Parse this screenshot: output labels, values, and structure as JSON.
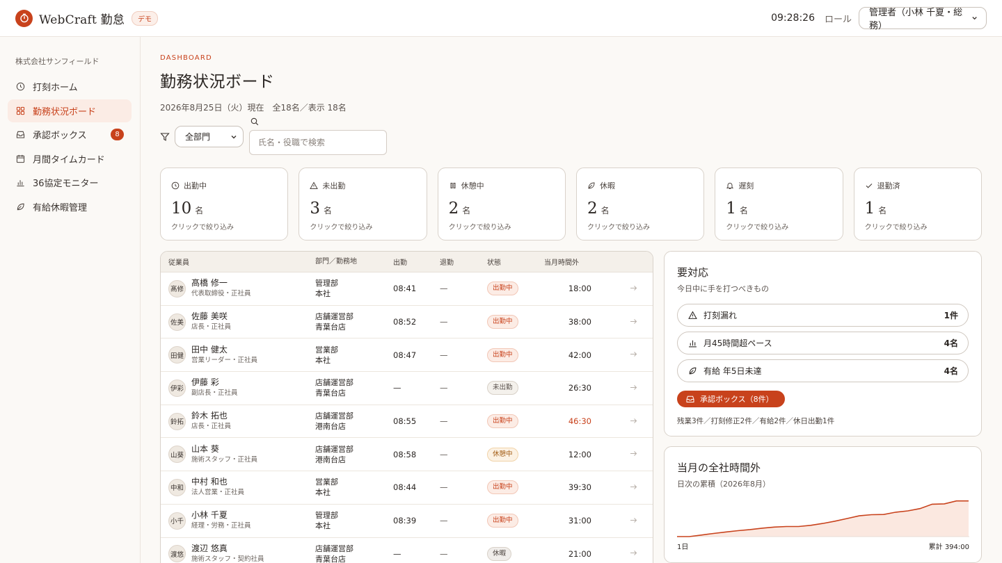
{
  "app": {
    "title": "WebCraft 勤怠",
    "demo_badge": "デモ"
  },
  "header": {
    "clock": "09:28:26",
    "role_label": "ロール",
    "role_value": "管理者（小林 千夏・総務）"
  },
  "sidebar": {
    "company": "株式会社サンフィールド",
    "items": [
      {
        "label": "打刻ホーム",
        "icon": "clock-icon"
      },
      {
        "label": "勤務状況ボード",
        "icon": "grid-icon",
        "active": true
      },
      {
        "label": "承認ボックス",
        "icon": "inbox-icon",
        "badge": "8"
      },
      {
        "label": "月間タイムカード",
        "icon": "calendar-icon"
      },
      {
        "label": "36協定モニター",
        "icon": "bar-chart-icon"
      },
      {
        "label": "有給休暇管理",
        "icon": "leaf-icon"
      }
    ]
  },
  "page": {
    "eyebrow": "DASHBOARD",
    "title": "勤務状況ボード",
    "subline": "2026年8月25日（火）現在　全18名／表示 18名"
  },
  "filters": {
    "department_value": "全部門",
    "search_placeholder": "氏名・役職で検索"
  },
  "stats": [
    {
      "label": "出勤中",
      "value": "10",
      "unit": "名",
      "hint": "クリックで絞り込み",
      "icon": "clock-icon"
    },
    {
      "label": "未出勤",
      "value": "3",
      "unit": "名",
      "hint": "クリックで絞り込み",
      "icon": "warning-icon"
    },
    {
      "label": "休憩中",
      "value": "2",
      "unit": "名",
      "hint": "クリックで絞り込み",
      "icon": "pause-icon"
    },
    {
      "label": "休暇",
      "value": "2",
      "unit": "名",
      "hint": "クリックで絞り込み",
      "icon": "leaf-icon"
    },
    {
      "label": "遅刻",
      "value": "1",
      "unit": "名",
      "hint": "クリックで絞り込み",
      "icon": "bell-icon"
    },
    {
      "label": "退勤済",
      "value": "1",
      "unit": "名",
      "hint": "クリックで絞り込み",
      "icon": "check-icon"
    }
  ],
  "table": {
    "headers": {
      "employee": "従業員",
      "dept": "部門／勤務地",
      "in": "出勤",
      "out": "退勤",
      "status": "状態",
      "overtime": "当月時間外"
    },
    "rows": [
      {
        "avatar": "髙修",
        "name": "髙橋 修一",
        "role": "代表取締役・正社員",
        "dept": "管理部",
        "site": "本社",
        "in": "08:41",
        "out": "—",
        "status": "出勤中",
        "status_type": "work",
        "overtime": "18:00",
        "warn": false
      },
      {
        "avatar": "佐美",
        "name": "佐藤 美咲",
        "role": "店長・正社員",
        "dept": "店舗運営部",
        "site": "青葉台店",
        "in": "08:52",
        "out": "—",
        "status": "出勤中",
        "status_type": "work",
        "overtime": "38:00",
        "warn": false
      },
      {
        "avatar": "田健",
        "name": "田中 健太",
        "role": "営業リーダー・正社員",
        "dept": "営業部",
        "site": "本社",
        "in": "08:47",
        "out": "—",
        "status": "出勤中",
        "status_type": "work",
        "overtime": "42:00",
        "warn": false
      },
      {
        "avatar": "伊彩",
        "name": "伊藤 彩",
        "role": "副店長・正社員",
        "dept": "店舗運営部",
        "site": "青葉台店",
        "in": "—",
        "out": "—",
        "status": "未出勤",
        "status_type": "absent",
        "overtime": "26:30",
        "warn": false
      },
      {
        "avatar": "鈴拓",
        "name": "鈴木 拓也",
        "role": "店長・正社員",
        "dept": "店舗運営部",
        "site": "港南台店",
        "in": "08:55",
        "out": "—",
        "status": "出勤中",
        "status_type": "work",
        "overtime": "46:30",
        "warn": true
      },
      {
        "avatar": "山葵",
        "name": "山本 葵",
        "role": "施術スタッフ・正社員",
        "dept": "店舗運営部",
        "site": "港南台店",
        "in": "08:58",
        "out": "—",
        "status": "休憩中",
        "status_type": "break",
        "overtime": "12:00",
        "warn": false
      },
      {
        "avatar": "中和",
        "name": "中村 和也",
        "role": "法人営業・正社員",
        "dept": "営業部",
        "site": "本社",
        "in": "08:44",
        "out": "—",
        "status": "出勤中",
        "status_type": "work",
        "overtime": "39:30",
        "warn": false
      },
      {
        "avatar": "小千",
        "name": "小林 千夏",
        "role": "経理・労務・正社員",
        "dept": "管理部",
        "site": "本社",
        "in": "08:39",
        "out": "—",
        "status": "出勤中",
        "status_type": "work",
        "overtime": "31:00",
        "warn": false
      },
      {
        "avatar": "渡悠",
        "name": "渡辺 悠真",
        "role": "施術スタッフ・契約社員",
        "dept": "店舗運営部",
        "site": "青葉台店",
        "in": "—",
        "out": "—",
        "status": "休暇",
        "status_type": "leave",
        "overtime": "21:00",
        "warn": false
      }
    ]
  },
  "todo": {
    "title": "要対応",
    "subtitle": "今日中に手を打つべきもの",
    "items": [
      {
        "label": "打刻漏れ",
        "count": "1件",
        "icon": "warning-icon"
      },
      {
        "label": "月45時間超ペース",
        "count": "4名",
        "icon": "bar-chart-icon"
      },
      {
        "label": "有給 年5日未達",
        "count": "4名",
        "icon": "leaf-icon"
      }
    ],
    "approve_button": "承認ボックス（8件）",
    "breakdown": "残業3件／打刻修正2件／有給2件／休日出勤1件"
  },
  "overtime_card": {
    "title": "当月の全社時間外",
    "subtitle": "日次の累積（2026年8月）",
    "start_label": "1日",
    "total_label": "累計 394:00"
  },
  "chart_data": {
    "type": "area",
    "x": [
      1,
      2,
      3,
      4,
      5,
      6,
      7,
      8,
      9,
      10,
      11,
      12,
      13,
      14,
      15,
      16,
      17,
      18,
      19,
      20,
      21,
      22,
      23,
      24,
      25
    ],
    "values": [
      0,
      0,
      16,
      33,
      48,
      62,
      74,
      88,
      100,
      106,
      106,
      118,
      138,
      162,
      190,
      218,
      230,
      232,
      256,
      270,
      294,
      340,
      344,
      374,
      374
    ],
    "ylim": [
      0,
      394
    ],
    "color": "#c8421c"
  },
  "colors": {
    "accent": "#c8421c",
    "accent_soft": "#fbece5"
  }
}
